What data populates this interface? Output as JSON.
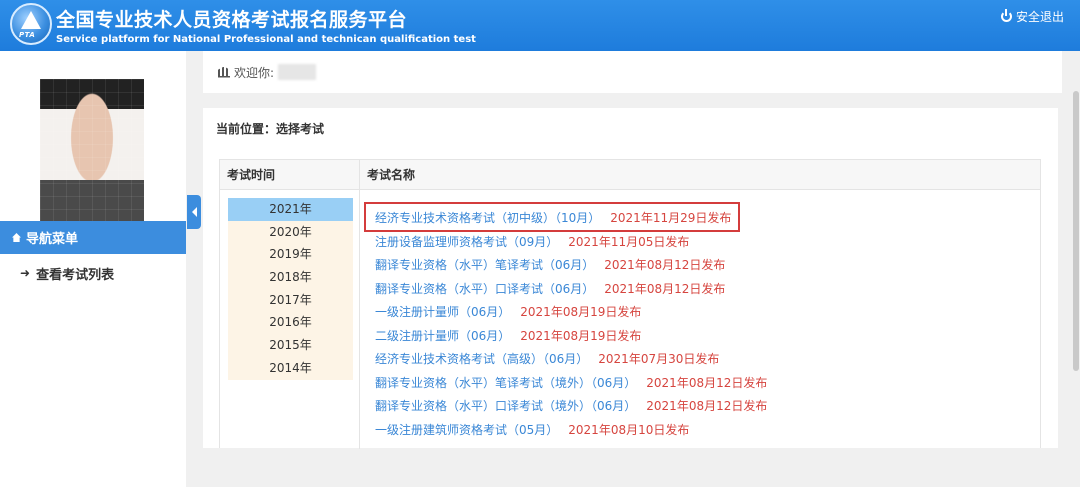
{
  "header": {
    "title": "全国专业技术人员资格考试报名服务平台",
    "subtitle": "Service platform for National Professional and technican qualification test",
    "logo_text": "PTA",
    "logout_label": "安全退出"
  },
  "sidebar": {
    "nav_header": "导航菜单",
    "items": [
      {
        "label": "查看考试列表"
      }
    ]
  },
  "welcome": {
    "label": "欢迎你:"
  },
  "breadcrumb": "当前位置：选择考试",
  "table": {
    "headers": {
      "time": "考试时间",
      "name": "考试名称"
    },
    "years": [
      "2021年",
      "2020年",
      "2019年",
      "2018年",
      "2017年",
      "2016年",
      "2015年",
      "2014年"
    ],
    "selected_year": "2021年",
    "exams": [
      {
        "title": "经济专业技术资格考试（初中级）（10月）",
        "date": "2021年11月29日发布"
      },
      {
        "title": "注册设备监理师资格考试（09月）",
        "date": "2021年11月05日发布"
      },
      {
        "title": "翻译专业资格（水平）笔译考试（06月）",
        "date": "2021年08月12日发布"
      },
      {
        "title": "翻译专业资格（水平）口译考试（06月）",
        "date": "2021年08月12日发布"
      },
      {
        "title": "一级注册计量师（06月）",
        "date": "2021年08月19日发布"
      },
      {
        "title": "二级注册计量师（06月）",
        "date": "2021年08月19日发布"
      },
      {
        "title": "经济专业技术资格考试（高级）（06月）",
        "date": "2021年07月30日发布"
      },
      {
        "title": "翻译专业资格（水平）笔译考试（境外）（06月）",
        "date": "2021年08月12日发布"
      },
      {
        "title": "翻译专业资格（水平）口译考试（境外）（06月）",
        "date": "2021年08月12日发布"
      },
      {
        "title": "一级注册建筑师资格考试（05月）",
        "date": "2021年08月10日发布"
      }
    ]
  },
  "colors": {
    "header_blue": "#1e7cdc",
    "nav_blue": "#3c8dde",
    "link_blue": "#3a87d6",
    "date_red": "#d6453f",
    "highlight_red": "#d43c3c",
    "year_active": "#99cff5",
    "year_bg": "#fdf4e6"
  }
}
